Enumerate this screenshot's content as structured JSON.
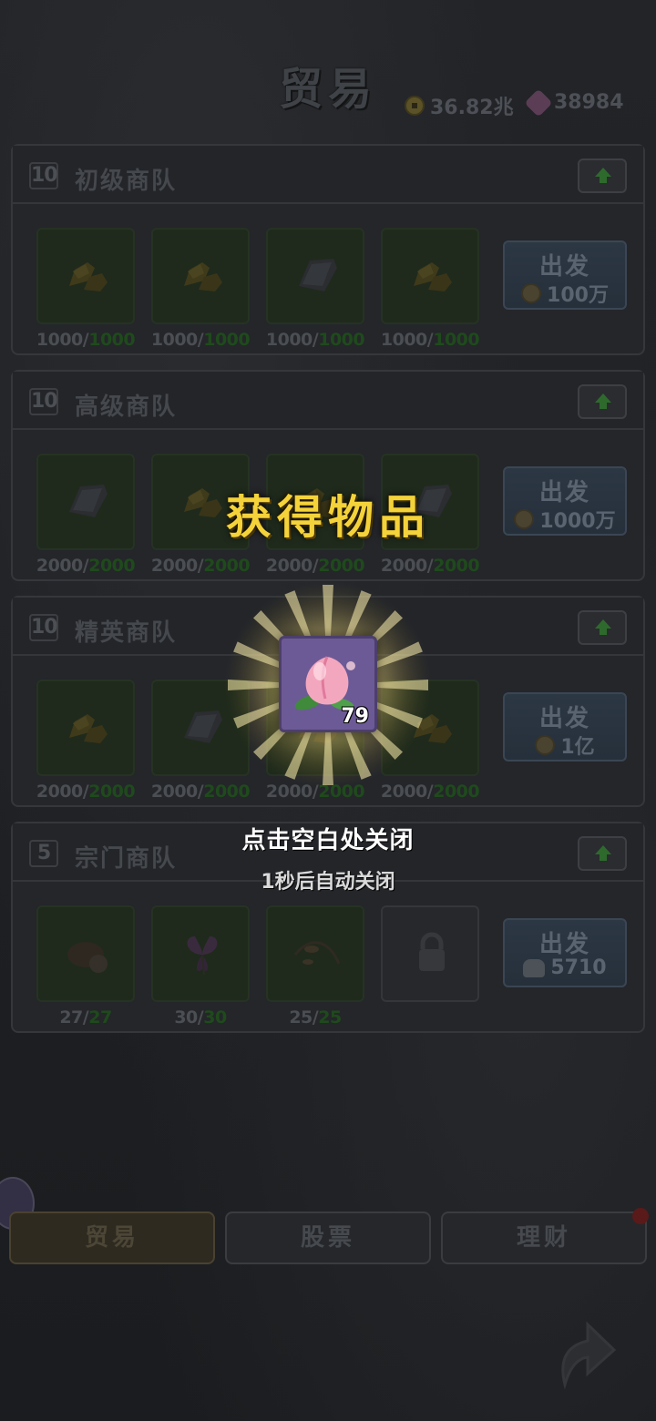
{
  "header": {
    "title": "贸易",
    "coins": "36.82兆",
    "gems": "38984"
  },
  "caravans": [
    {
      "level": "10",
      "name": "初级商队",
      "slots": [
        {
          "icon": "gold-ore-icon",
          "current": "1000/",
          "max": "1000"
        },
        {
          "icon": "gold-ore-icon",
          "current": "1000/",
          "max": "1000"
        },
        {
          "icon": "iron-ore-icon",
          "current": "1000/",
          "max": "1000"
        },
        {
          "icon": "gold-ore-icon",
          "current": "1000/",
          "max": "1000"
        }
      ],
      "go_label": "出发",
      "cost": "100万",
      "cost_icon": "coin-icon"
    },
    {
      "level": "10",
      "name": "高级商队",
      "slots": [
        {
          "icon": "iron-ore-icon",
          "current": "2000/",
          "max": "2000"
        },
        {
          "icon": "gold-ore-icon",
          "current": "2000/",
          "max": "2000"
        },
        {
          "icon": "gold-ore-icon",
          "current": "2000/",
          "max": "2000"
        },
        {
          "icon": "iron-ore-icon",
          "current": "2000/",
          "max": "2000"
        }
      ],
      "go_label": "出发",
      "cost": "1000万",
      "cost_icon": "coin-icon"
    },
    {
      "level": "10",
      "name": "精英商队",
      "slots": [
        {
          "icon": "gold-ore-icon",
          "current": "2000/",
          "max": "2000"
        },
        {
          "icon": "iron-ore-icon",
          "current": "2000/",
          "max": "2000"
        },
        {
          "icon": "gold-ore-icon",
          "current": "2000/",
          "max": "2000"
        },
        {
          "icon": "gold-ore-icon",
          "current": "2000/",
          "max": "2000"
        }
      ],
      "go_label": "出发",
      "cost": "1亿",
      "cost_icon": "coin-icon"
    },
    {
      "level": "5",
      "name": "宗门商队",
      "slots": [
        {
          "icon": "rock-icon",
          "current": "27/",
          "max": "27"
        },
        {
          "icon": "flower-icon",
          "current": "30/",
          "max": "30"
        },
        {
          "icon": "herb-icon",
          "current": "25/",
          "max": "25"
        },
        {
          "icon": "lock-icon",
          "current": "",
          "max": ""
        }
      ],
      "go_label": "出发",
      "cost": "5710",
      "cost_icon": "silver-ingot-icon"
    }
  ],
  "nav": {
    "tabs": [
      "贸易",
      "股票",
      "理财"
    ],
    "active": "贸易"
  },
  "reward": {
    "title": "获得物品",
    "item_icon": "peach-icon",
    "quantity": "79",
    "hint_close": "点击空白处关闭",
    "hint_auto": "1秒后自动关闭"
  },
  "colors": {
    "reward_title": "#f4d23a",
    "item_frame": "#6c5a96",
    "max_count": "#1f4a1c"
  }
}
